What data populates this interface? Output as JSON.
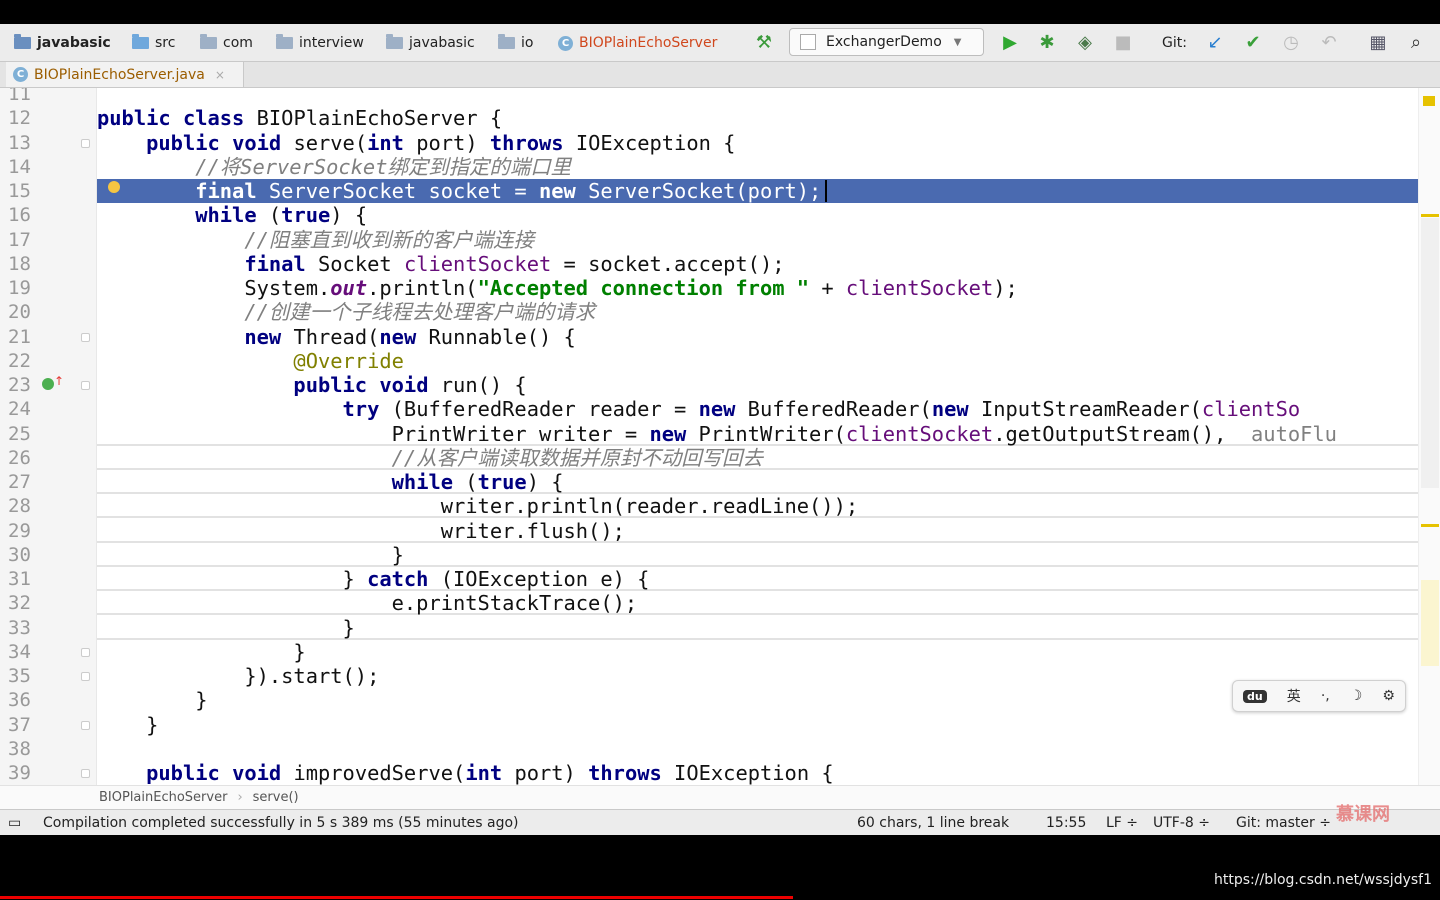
{
  "nav": {
    "breadcrumbs": [
      {
        "label": "javabasic",
        "icon": "project-icon"
      },
      {
        "label": "src",
        "icon": "folder-icon"
      },
      {
        "label": "com",
        "icon": "package-icon"
      },
      {
        "label": "interview",
        "icon": "package-icon"
      },
      {
        "label": "javabasic",
        "icon": "package-icon"
      },
      {
        "label": "io",
        "icon": "package-icon"
      },
      {
        "label": "BIOPlainEchoServer",
        "icon": "class-icon"
      }
    ],
    "run_config": "ExchangerDemo",
    "git_label": "Git:"
  },
  "tab": {
    "file_name": "BIOPlainEchoServer.java",
    "close_glyph": "×"
  },
  "editor": {
    "highlighted_line": 15,
    "lines": [
      {
        "n": "11",
        "code": ""
      },
      {
        "n": "12",
        "code": "public class BIOPlainEchoServer {"
      },
      {
        "n": "13",
        "code": "    public void serve(int port) throws IOException {"
      },
      {
        "n": "14",
        "code": "        //将ServerSocket绑定到指定的端口里"
      },
      {
        "n": "15",
        "code": "        final ServerSocket socket = new ServerSocket(port);"
      },
      {
        "n": "16",
        "code": "        while (true) {"
      },
      {
        "n": "17",
        "code": "            //阻塞直到收到新的客户端连接"
      },
      {
        "n": "18",
        "code": "            final Socket clientSocket = socket.accept();"
      },
      {
        "n": "19",
        "code": "            System.out.println(\"Accepted connection from \" + clientSocket);"
      },
      {
        "n": "20",
        "code": "            //创建一个子线程去处理客户端的请求"
      },
      {
        "n": "21",
        "code": "            new Thread(new Runnable() {"
      },
      {
        "n": "22",
        "code": "                @Override"
      },
      {
        "n": "23",
        "code": "                public void run() {"
      },
      {
        "n": "24",
        "code": "                    try (BufferedReader reader = new BufferedReader(new InputStreamReader(clientSo"
      },
      {
        "n": "25",
        "code": "                        PrintWriter writer = new PrintWriter(clientSocket.getOutputStream(),  autoFlu"
      },
      {
        "n": "26",
        "code": "                        //从客户端读取数据并原封不动回写回去"
      },
      {
        "n": "27",
        "code": "                        while (true) {"
      },
      {
        "n": "28",
        "code": "                            writer.println(reader.readLine());"
      },
      {
        "n": "29",
        "code": "                            writer.flush();"
      },
      {
        "n": "30",
        "code": "                        }"
      },
      {
        "n": "31",
        "code": "                    } catch (IOException e) {"
      },
      {
        "n": "32",
        "code": "                        e.printStackTrace();"
      },
      {
        "n": "33",
        "code": "                    }"
      },
      {
        "n": "34",
        "code": "                }"
      },
      {
        "n": "35",
        "code": "            }).start();"
      },
      {
        "n": "36",
        "code": "        }"
      },
      {
        "n": "37",
        "code": "    }"
      },
      {
        "n": "38",
        "code": ""
      },
      {
        "n": "39",
        "code": "    public void improvedServe(int port) throws IOException {"
      }
    ]
  },
  "code_breadcrumb": {
    "class": "BIOPlainEchoServer",
    "method": "serve()"
  },
  "status": {
    "message": "Compilation completed successfully in 5 s 389 ms (55 minutes ago)",
    "selection": "60 chars, 1 line break",
    "position": "15:55",
    "line_sep": "LF ÷",
    "encoding": "UTF-8 ÷",
    "git_branch": "Git: master ÷"
  },
  "ime": {
    "logo": "du",
    "lang": "英",
    "punct": "·,",
    "moon": "☽",
    "gear": "⚙"
  },
  "watermark": "慕课网",
  "footer_url": "https://blog.csdn.net/wssjdysf1"
}
